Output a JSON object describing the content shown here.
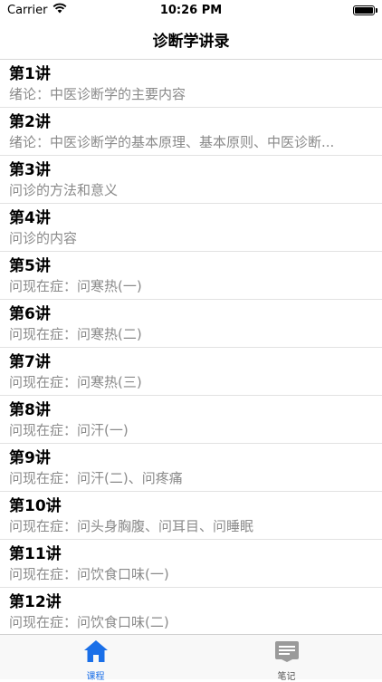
{
  "status": {
    "carrier": "Carrier",
    "time": "10:26 PM"
  },
  "nav": {
    "title": "诊断学讲录"
  },
  "lectures": [
    {
      "title": "第1讲",
      "subtitle": "绪论：中医诊断学的主要内容"
    },
    {
      "title": "第2讲",
      "subtitle": "绪论：中医诊断学的基本原理、基本原则、中医诊断..."
    },
    {
      "title": "第3讲",
      "subtitle": "问诊的方法和意义"
    },
    {
      "title": "第4讲",
      "subtitle": "问诊的内容"
    },
    {
      "title": "第5讲",
      "subtitle": "问现在症：问寒热(一)"
    },
    {
      "title": "第6讲",
      "subtitle": "问现在症：问寒热(二)"
    },
    {
      "title": "第7讲",
      "subtitle": "问现在症：问寒热(三)"
    },
    {
      "title": "第8讲",
      "subtitle": "问现在症：问汗(一)"
    },
    {
      "title": "第9讲",
      "subtitle": "问现在症：问汗(二)、问疼痛"
    },
    {
      "title": "第10讲",
      "subtitle": "问现在症：问头身胸腹、问耳目、问睡眠"
    },
    {
      "title": "第11讲",
      "subtitle": "问现在症：问饮食口味(一)"
    },
    {
      "title": "第12讲",
      "subtitle": "问现在症：问饮食口味(二)"
    }
  ],
  "tabs": [
    {
      "label": "课程",
      "icon": "home-icon",
      "active": true
    },
    {
      "label": "笔记",
      "icon": "notebook-icon",
      "active": false
    }
  ],
  "colors": {
    "accent": "#1a6fe8",
    "inactive_icon": "#9a9a9a"
  }
}
